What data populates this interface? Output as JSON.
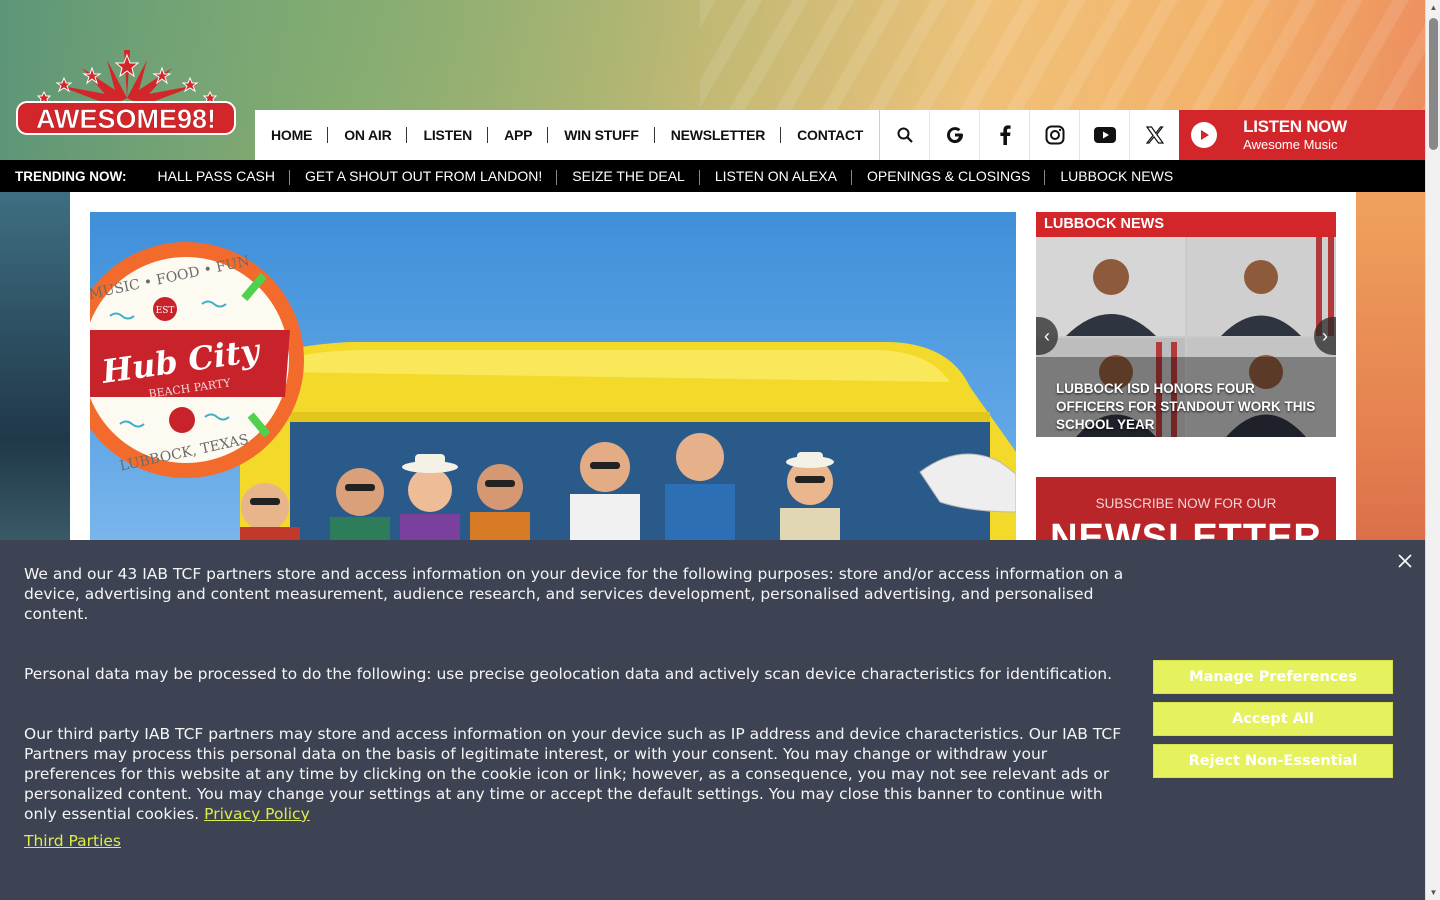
{
  "logo": {
    "text": "AWESOME98!"
  },
  "nav": {
    "items": [
      "HOME",
      "ON AIR",
      "LISTEN",
      "APP",
      "WIN STUFF",
      "NEWSLETTER",
      "CONTACT"
    ],
    "icons": [
      "search-icon",
      "google-icon",
      "facebook-icon",
      "instagram-icon",
      "youtube-icon",
      "x-icon"
    ]
  },
  "listen": {
    "title": "LISTEN NOW",
    "subtitle": "Awesome Music"
  },
  "trending": {
    "label": "TRENDING NOW:",
    "items": [
      "HALL PASS CASH",
      "GET A SHOUT OUT FROM LANDON!",
      "SEIZE THE DEAL",
      "LISTEN ON ALEXA",
      "OPENINGS & CLOSINGS",
      "LUBBOCK NEWS"
    ]
  },
  "hero": {
    "badge_top": "MUSIC • FOOD • FUN",
    "badge_est": "EST",
    "badge_title": "Hub City",
    "badge_subtitle": "BEACH PARTY",
    "badge_bottom": "LUBBOCK, TEXAS"
  },
  "news": {
    "header": "LUBBOCK NEWS",
    "title": "LUBBOCK ISD HONORS FOUR OFFICERS FOR STANDOUT WORK THIS SCHOOL YEAR"
  },
  "subscribe": {
    "small": "SUBSCRIBE NOW FOR OUR",
    "big": "NEWSLETTER"
  },
  "cookie": {
    "p1": "We and our 43 IAB TCF partners store and access information on your device for the following purposes: store and/or access information on a device, advertising and content measurement, audience research, and services development, personalised advertising, and personalised content.",
    "p2": "Personal data may be processed to do the following: use precise geolocation data and actively scan device characteristics for identification.",
    "p3": "Our third party IAB TCF partners may store and access information on your device such as IP address and device characteristics. Our IAB TCF Partners may process this personal data on the basis of legitimate interest, or with your consent. You may change or withdraw your preferences for this website at any time by clicking on the cookie icon or link; however, as a consequence, you may not see relevant ads or personalized content. You may change your settings at any time or accept the default settings. You may close this banner to continue with only essential cookies.",
    "privacy_link": "Privacy Policy",
    "third_parties": "Third Parties",
    "buttons": [
      "Manage Preferences",
      "Accept All",
      "Reject Non-Essential"
    ]
  },
  "colors": {
    "brand_red": "#d3262a",
    "banner_bg": "#3d4352",
    "button_yellow": "#e6f25d",
    "link_yellow": "#dcec4a"
  }
}
